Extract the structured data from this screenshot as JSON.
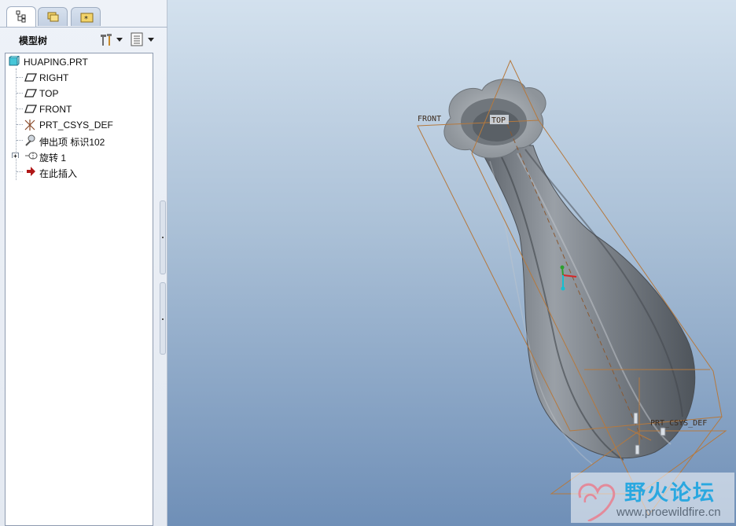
{
  "panel": {
    "title": "模型树",
    "tabs": [
      {
        "name": "model-tree-tab",
        "icon": "model-tree-icon",
        "active": true
      },
      {
        "name": "folder-browser-tab",
        "icon": "folders-icon",
        "active": false
      },
      {
        "name": "favorites-tab",
        "icon": "favorites-folder-icon",
        "active": false
      }
    ],
    "header_buttons": [
      {
        "name": "settings-button",
        "icon": "tools-icon"
      },
      {
        "name": "show-button",
        "icon": "list-icon"
      }
    ]
  },
  "model_tree": {
    "items": [
      {
        "label": "HUAPING.PRT",
        "icon": "part-icon"
      },
      {
        "label": "RIGHT",
        "icon": "datum-plane-icon"
      },
      {
        "label": "TOP",
        "icon": "datum-plane-icon"
      },
      {
        "label": "FRONT",
        "icon": "datum-plane-icon"
      },
      {
        "label": "PRT_CSYS_DEF",
        "icon": "coordinate-system-icon"
      },
      {
        "label": "伸出项 标识102",
        "icon": "protrusion-icon"
      },
      {
        "label": "旋转 1",
        "icon": "revolve-icon"
      },
      {
        "label": "在此插入",
        "icon": "insert-here-arrow-icon"
      }
    ]
  },
  "viewport": {
    "datum_labels": {
      "front": "FRONT",
      "top_plane": "TOP",
      "csys": "PRT_CSYS_DEF"
    },
    "colors": {
      "datum": "#b5793e",
      "model": "#8a9098"
    }
  },
  "watermark": {
    "text": "野火论坛",
    "url": "www.proewildfire.cn"
  }
}
